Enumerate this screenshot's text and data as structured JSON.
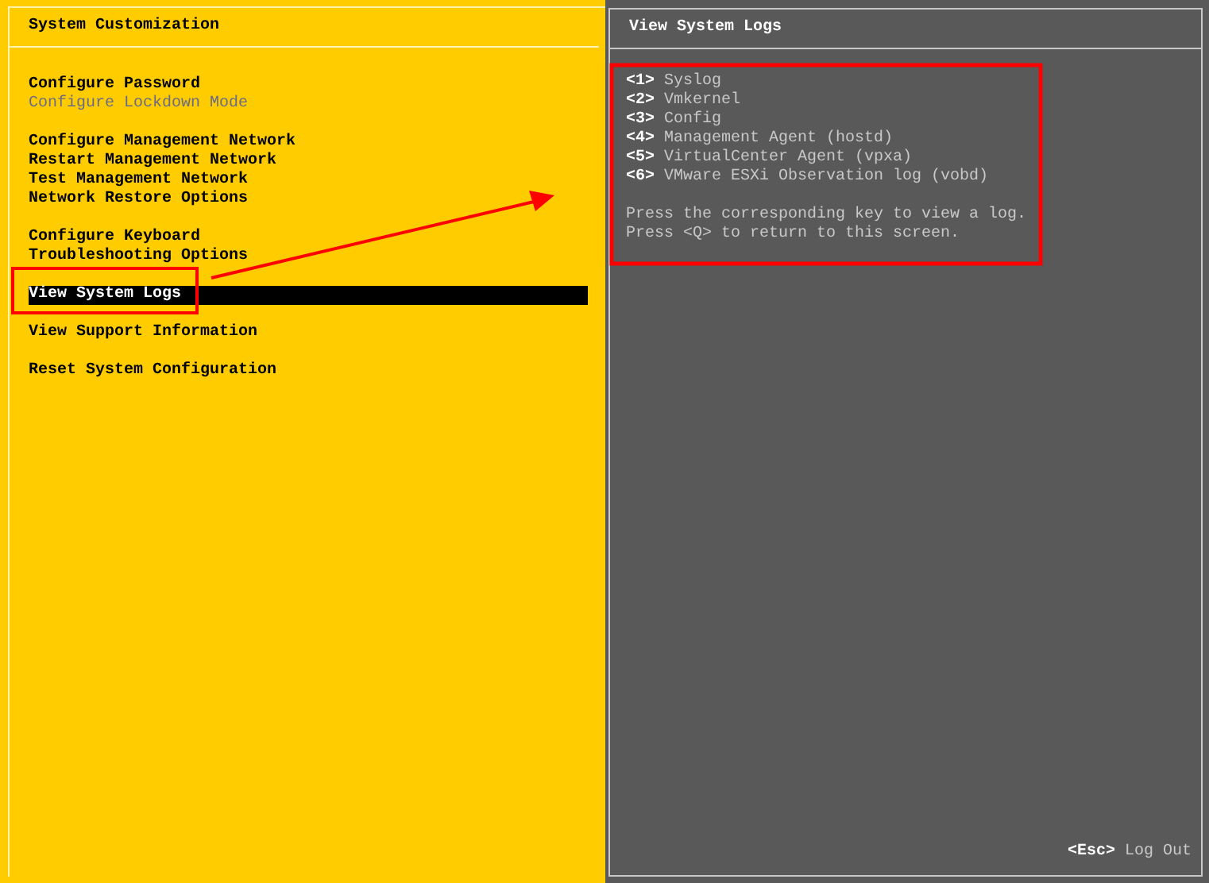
{
  "left_panel": {
    "title": "System Customization",
    "groups": [
      {
        "items": [
          {
            "label": "Configure Password",
            "disabled": false,
            "selected": false
          },
          {
            "label": "Configure Lockdown Mode",
            "disabled": true,
            "selected": false
          }
        ]
      },
      {
        "items": [
          {
            "label": "Configure Management Network",
            "disabled": false,
            "selected": false
          },
          {
            "label": "Restart Management Network",
            "disabled": false,
            "selected": false
          },
          {
            "label": "Test Management Network",
            "disabled": false,
            "selected": false
          },
          {
            "label": "Network Restore Options",
            "disabled": false,
            "selected": false
          }
        ]
      },
      {
        "items": [
          {
            "label": "Configure Keyboard",
            "disabled": false,
            "selected": false
          },
          {
            "label": "Troubleshooting Options",
            "disabled": false,
            "selected": false
          }
        ]
      },
      {
        "items": [
          {
            "label": "View System Logs",
            "disabled": false,
            "selected": true
          }
        ]
      },
      {
        "items": [
          {
            "label": "View Support Information",
            "disabled": false,
            "selected": false
          }
        ]
      },
      {
        "items": [
          {
            "label": "Reset System Configuration",
            "disabled": false,
            "selected": false
          }
        ]
      }
    ]
  },
  "right_panel": {
    "title": "View System Logs",
    "logs": [
      {
        "key": "<1>",
        "label": "Syslog"
      },
      {
        "key": "<2>",
        "label": "Vmkernel"
      },
      {
        "key": "<3>",
        "label": "Config"
      },
      {
        "key": "<4>",
        "label": "Management Agent (hostd)"
      },
      {
        "key": "<5>",
        "label": "VirtualCenter Agent (vpxa)"
      },
      {
        "key": "<6>",
        "label": "VMware ESXi Observation log (vobd)"
      }
    ],
    "instructions": [
      "Press the corresponding key to view a log.",
      "Press <Q> to return to this screen."
    ]
  },
  "footer": {
    "key": "<Esc>",
    "label": "Log Out"
  }
}
